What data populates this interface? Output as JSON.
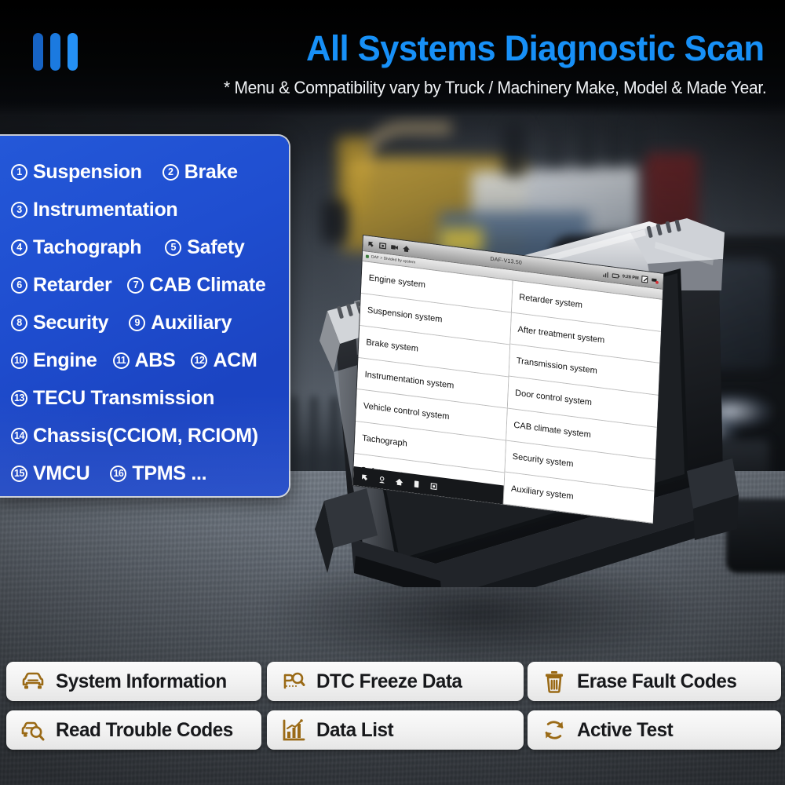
{
  "header": {
    "logo": "three-bars-logo",
    "title": "All Systems Diagnostic Scan",
    "subtitle": "* Menu & Compatibility vary by Truck / Machinery Make, Model & Made Year.",
    "title_color": "#1790f7"
  },
  "systems_panel": {
    "accent_color": "#1f4ed0",
    "rows": [
      [
        {
          "num": "1",
          "label": "Suspension"
        },
        {
          "num": "2",
          "label": "Brake"
        }
      ],
      [
        {
          "num": "3",
          "label": "Instrumentation"
        }
      ],
      [
        {
          "num": "4",
          "label": "Tachograph"
        },
        {
          "num": "5",
          "label": "Safety"
        }
      ],
      [
        {
          "num": "6",
          "label": "Retarder"
        },
        {
          "num": "7",
          "label": "CAB Climate"
        }
      ],
      [
        {
          "num": "8",
          "label": "Security"
        },
        {
          "num": "9",
          "label": "Auxiliary"
        }
      ],
      [
        {
          "num": "10",
          "label": "Engine"
        },
        {
          "num": "11",
          "label": "ABS"
        },
        {
          "num": "12",
          "label": "ACM"
        }
      ],
      [
        {
          "num": "13",
          "label": "TECU Transmission"
        }
      ],
      [
        {
          "num": "14",
          "label": "Chassis(CCIOM, RCIOM)"
        }
      ],
      [
        {
          "num": "15",
          "label": "VMCU"
        },
        {
          "num": "16",
          "label": "TPMS ..."
        }
      ]
    ]
  },
  "tablet": {
    "status_bar": {
      "title": "DAF-V13.50",
      "time": "9:28 PM",
      "left_icons": [
        "back-icon",
        "screenshot-icon",
        "record-icon",
        "home-icon"
      ],
      "right_icons": [
        "signal-icon",
        "battery-icon",
        "note-icon",
        "vci-icon"
      ]
    },
    "breadcrumb": "DAF > Divided by system",
    "menu_left": [
      "Engine system",
      "Suspension system",
      "Brake system",
      "Instrumentation system",
      "Vehicle control system",
      "Tachograph",
      "Safety system"
    ],
    "menu_right": [
      "Retarder system",
      "After treatment system",
      "Transmission system",
      "Door control system",
      "CAB climate system",
      "Security system",
      "Auxiliary system"
    ],
    "nav_icons": [
      "back-icon",
      "help-icon",
      "home-icon",
      "print-icon",
      "screenshot-icon"
    ]
  },
  "features": {
    "icon_color": "#9a6a16",
    "items": [
      {
        "icon": "car-front-icon",
        "label": "System Information"
      },
      {
        "icon": "dtc-freeze-icon",
        "label": "DTC Freeze Data"
      },
      {
        "icon": "trash-icon",
        "label": "Erase Fault Codes"
      },
      {
        "icon": "car-search-icon",
        "label": "Read Trouble Codes"
      },
      {
        "icon": "bar-chart-icon",
        "label": "Data List"
      },
      {
        "icon": "refresh-icon",
        "label": "Active Test"
      }
    ]
  }
}
